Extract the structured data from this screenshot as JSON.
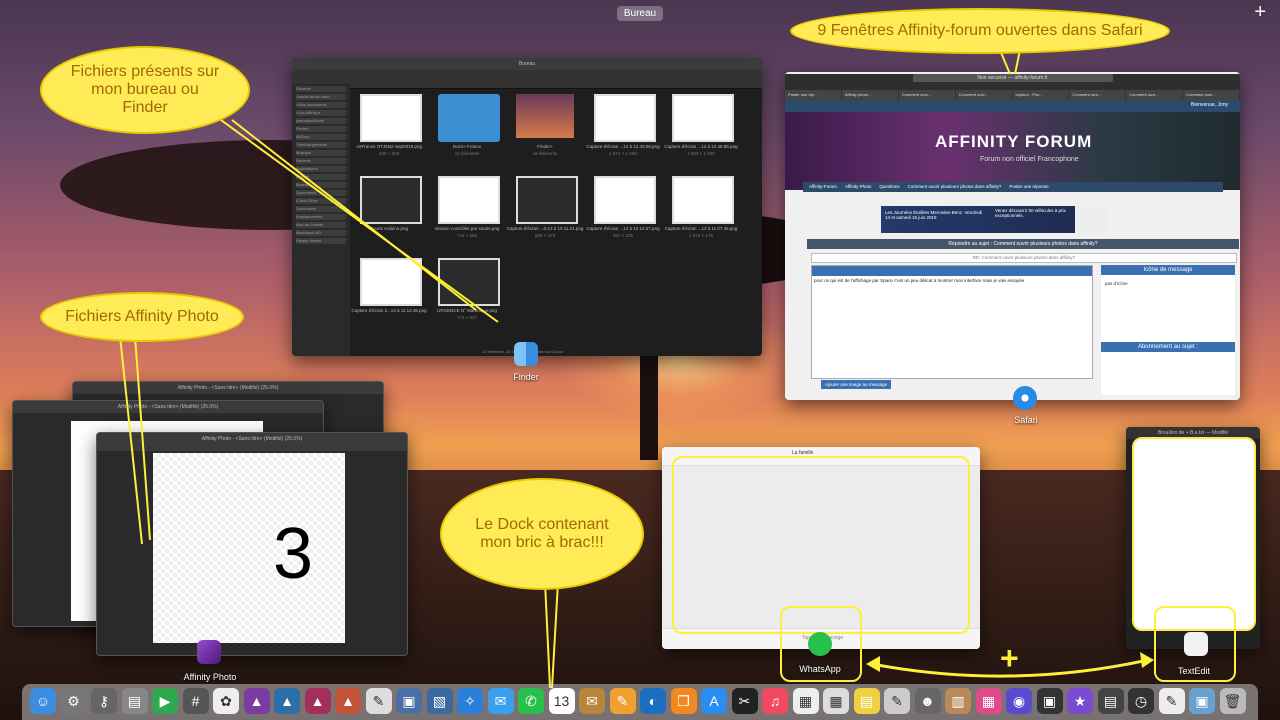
{
  "desktop": {
    "space_label": "Bureau"
  },
  "finder": {
    "window_title": "Bureau",
    "files": [
      {
        "name": "AirFrance OTJ5N2 sept2018.png",
        "dims": "400 × 808"
      },
      {
        "name": "Docs> France",
        "dims": "12 éléments"
      },
      {
        "name": "Finder>",
        "dims": "16 éléments"
      },
      {
        "name": "Capture d'écran ...12 à 12.43.08.png",
        "dims": "1 671 × 1 060"
      },
      {
        "name": "Capture d'écran ...12 à 12.45.56.png",
        "dims": "1 503 × 1 060"
      },
      {
        "name": "Souris Arduino.png",
        "dims": ""
      },
      {
        "name": "mission contrôlée par souris.png",
        "dims": "742 × 582"
      },
      {
        "name": "Capture d'écran ...6-13 à 10.11.01.png",
        "dims": "626 × 378"
      },
      {
        "name": "Capture d'écran ...13 à 10.14.57.png",
        "dims": "457 × 236"
      },
      {
        "name": "Capture d'écran ...13 à 11.07.46.png",
        "dims": "1 570 × 178"
      },
      {
        "name": "Capture d'écran 2...13 à 11.12.36.png",
        "dims": ""
      },
      {
        "name": "URGENCE N° Martinique.png",
        "dims": "774 × 827"
      }
    ],
    "sidebar": [
      "Récents",
      "Josette déclé sans...",
      "<Mes documents",
      "<Les Affinity's",
      "jeanobjonMoutil",
      "Finder>",
      "AirDrop",
      "Téléchargements",
      "Musique",
      "Récents",
      "Applications",
      "Images",
      "Bureau",
      "Documents",
      "iCloud Drive",
      "Documents",
      "Emplacements",
      "Mac de Josette",
      "Macintosh HD",
      "Disque distant"
    ],
    "status": "12 éléments, 15,25 Go disponibles sur iCloud",
    "app_label": "Finder"
  },
  "safari": {
    "url": "Non sécurisé — affinity-forum.fr",
    "tabs": [
      "Poster une rép...",
      "Affinity photo...",
      "Comment ouvr...",
      "Comment ouvr...",
      "capture - Pos...",
      "Comment ouvr...",
      "Comment ouvr...",
      "Comment ouvr..."
    ],
    "user": "Bienvenue, Jony",
    "forum_logo": "AFFINITY FORUM",
    "forum_subtitle": "Forum non officiel Francophone",
    "breadcrumb": [
      "Affinity-Forum",
      "Affinity Photo",
      "Questions",
      "Comment ouvrir plusieurs photos dans affinity?",
      "Poster une réponse"
    ],
    "ad_text": "Les Journées Étoilées Mercedes-Benz. Vendredi 14 et samedi 15 juin 2019",
    "ad_right": "Venez découvrir 50 véhicules à prix exceptionnels.",
    "reply_title": "Répondre au sujet : Comment ouvrir plusieurs photos dans affinity?",
    "subject": "RE: Comment ouvrir plusieurs photos dans affinity?",
    "message": "pour ce qui est de l'affichage par Space c'est un peu délicat à montrer mon interface   mais je vais essayée",
    "icon_title": "Icône de message",
    "no_icon": "pas d'icône",
    "sub_title": "Abonnement au sujet :",
    "add_image": "Ajouter une image au message",
    "app_label": "Safari"
  },
  "affinity": {
    "window_title": "Affinity Photo - <Sans titre> (Modifié) (25.0%)",
    "canvas_number": "3",
    "app_label": "Affinity Photo"
  },
  "whatsapp": {
    "chat_title": "La famille",
    "input_placeholder": "Taper un message",
    "app_label": "WhatsApp"
  },
  "textedit": {
    "window_title": "Brouillon de + B.e.txt — Modifié",
    "app_label": "TextEdit"
  },
  "annotations": {
    "bubble_finder": "Fichiers présents sur mon bureau ou Finder",
    "bubble_safari": "9 Fenêtres Affinity-forum ouvertes dans Safari",
    "bubble_affinity": "Fichiers Affinity Photo",
    "bubble_dock": "Le Dock contenant mon bric à brac!!!",
    "plus": "+"
  },
  "dock": {
    "items": [
      {
        "name": "finder-icon",
        "glyph": "☺",
        "color": "#3b8de0"
      },
      {
        "name": "system-preferences-icon",
        "glyph": "⚙",
        "color": "#777"
      },
      {
        "name": "keychain-icon",
        "glyph": "⚷",
        "color": "#666"
      },
      {
        "name": "printer-icon",
        "glyph": "▤",
        "color": "#888"
      },
      {
        "name": "facetime-icon",
        "glyph": "▶",
        "color": "#2fa84f"
      },
      {
        "name": "calculator-icon",
        "glyph": "#",
        "color": "#555"
      },
      {
        "name": "photos-icon",
        "glyph": "✿",
        "color": "#eee"
      },
      {
        "name": "affinity-photo-icon",
        "glyph": "▲",
        "color": "#7b3ca0"
      },
      {
        "name": "affinity-designer-icon",
        "glyph": "▲",
        "color": "#2c6fa8"
      },
      {
        "name": "affinity-publisher-icon",
        "glyph": "▲",
        "color": "#a2305a"
      },
      {
        "name": "affinity-icon",
        "glyph": "▲",
        "color": "#c2533a"
      },
      {
        "name": "preview-icon",
        "glyph": "✎",
        "color": "#ddd"
      },
      {
        "name": "screenshot-icon",
        "glyph": "▣",
        "color": "#4a6fa5"
      },
      {
        "name": "image-capture-icon",
        "glyph": "▧",
        "color": "#3a6aa0"
      },
      {
        "name": "safari-icon",
        "glyph": "✧",
        "color": "#2a7fd8"
      },
      {
        "name": "messages-icon",
        "glyph": "✉",
        "color": "#3aa0ee"
      },
      {
        "name": "whatsapp-icon",
        "glyph": "✆",
        "color": "#28c04a"
      },
      {
        "name": "calendar-icon",
        "glyph": "13",
        "color": "#fff"
      },
      {
        "name": "notes-icon",
        "glyph": "✉",
        "color": "#b8863b"
      },
      {
        "name": "pages-icon",
        "glyph": "✎",
        "color": "#f0a030"
      },
      {
        "name": "edge-icon",
        "glyph": "◐",
        "color": "#1a6fc0"
      },
      {
        "name": "books-icon",
        "glyph": "❒",
        "color": "#f08a20"
      },
      {
        "name": "app-store-icon",
        "glyph": "A",
        "color": "#2a8df0"
      },
      {
        "name": "dvd-icon",
        "glyph": "✂",
        "color": "#222"
      },
      {
        "name": "music-icon",
        "glyph": "♫",
        "color": "#f04a60"
      },
      {
        "name": "document-icon",
        "glyph": "▦",
        "color": "#eee"
      },
      {
        "name": "calculator2-icon",
        "glyph": "▦",
        "color": "#ddd"
      },
      {
        "name": "stickies-icon",
        "glyph": "▤",
        "color": "#f0d040"
      },
      {
        "name": "script-icon",
        "glyph": "✎",
        "color": "#ccc"
      },
      {
        "name": "automator-icon",
        "glyph": "☻",
        "color": "#666"
      },
      {
        "name": "archive-icon",
        "glyph": "▥",
        "color": "#b88a5a"
      },
      {
        "name": "flashcards-icon",
        "glyph": "▦",
        "color": "#e04a8a"
      },
      {
        "name": "siri-icon",
        "glyph": "◉",
        "color": "#5a4ad0"
      },
      {
        "name": "activity-monitor-icon",
        "glyph": "▣",
        "color": "#333"
      },
      {
        "name": "imovie-icon",
        "glyph": "★",
        "color": "#7a4ad0"
      },
      {
        "name": "console-icon",
        "glyph": "▤",
        "color": "#444"
      },
      {
        "name": "time-machine-icon",
        "glyph": "◷",
        "color": "#333"
      },
      {
        "name": "textedit-icon",
        "glyph": "✎",
        "color": "#eee"
      },
      {
        "name": "downloads-icon",
        "glyph": "▣",
        "color": "#6aa0d0"
      },
      {
        "name": "trash-icon",
        "glyph": "🗑",
        "color": "#bbb"
      }
    ]
  }
}
